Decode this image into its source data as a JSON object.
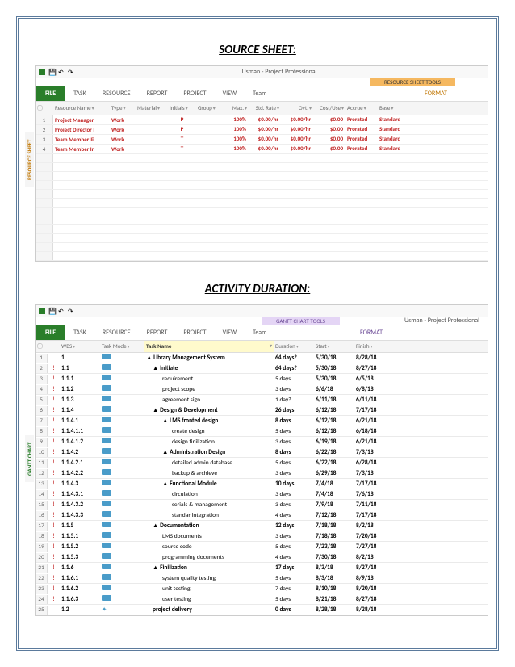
{
  "title1": "SOURCE SHEET:",
  "title2": "ACTIVITY DURATION:",
  "ribbon_tabs": [
    "FILE",
    "TASK",
    "RESOURCE",
    "REPORT",
    "PROJECT",
    "VIEW",
    "Team"
  ],
  "format_label": "FORMAT",
  "window1_title": "Usman - Project Professional",
  "tool_tab1": "RESOURCE SHEET TOOLS",
  "tool_tab2": "GANTT CHART TOOLS",
  "window2_title": "Usman - Project Professional",
  "side_label1": "RESOURCE SHEET",
  "side_label2": "GANTT CHART",
  "resource_headers": {
    "indicator": "",
    "rname": "Resource Name",
    "rtype": "Type",
    "material": "Material",
    "initials": "Initials",
    "group": "Group",
    "max": "Max.",
    "stdrate": "Std. Rate",
    "ovt": "Ovt.",
    "costuse": "Cost/Use",
    "accrue": "Accrue",
    "base": "Base"
  },
  "resources": [
    {
      "num": "1",
      "name": "Project Manager",
      "type": "Work",
      "initials": "P",
      "max": "100%",
      "std": "$0.00/hr",
      "ovt": "$0.00/hr",
      "cost": "$0.00",
      "accrue": "Prorated",
      "base": "Standard"
    },
    {
      "num": "2",
      "name": "Project Director I",
      "type": "Work",
      "initials": "P",
      "max": "100%",
      "std": "$0.00/hr",
      "ovt": "$0.00/hr",
      "cost": "$0.00",
      "accrue": "Prorated",
      "base": "Standard"
    },
    {
      "num": "3",
      "name": "Team Member Ji",
      "type": "Work",
      "initials": "T",
      "max": "100%",
      "std": "$0.00/hr",
      "ovt": "$0.00/hr",
      "cost": "$0.00",
      "accrue": "Prorated",
      "base": "Standard"
    },
    {
      "num": "4",
      "name": "Team Member In",
      "type": "Work",
      "initials": "T",
      "max": "100%",
      "std": "$0.00/hr",
      "ovt": "$0.00/hr",
      "cost": "$0.00",
      "accrue": "Prorated",
      "base": "Standard"
    }
  ],
  "gantt_headers": {
    "wbs": "WBS",
    "mode": "Task Mode",
    "tname": "Task Name",
    "dur": "Duration",
    "start": "Start",
    "finish": "Finish"
  },
  "tasks": [
    {
      "num": "1",
      "wbs": "1",
      "name": "Library Management System",
      "indent": 0,
      "bold": true,
      "dur": "64 days?",
      "start": "5/30/18",
      "finish": "8/28/18",
      "collapse": true,
      "ind": ""
    },
    {
      "num": "2",
      "wbs": "1.1",
      "name": "Initiate",
      "indent": 1,
      "bold": true,
      "dur": "64 days?",
      "start": "5/30/18",
      "finish": "8/27/18",
      "collapse": true,
      "ind": "!"
    },
    {
      "num": "3",
      "wbs": "1.1.1",
      "name": "requirement",
      "indent": 2,
      "bold": false,
      "dur": "5 days",
      "start": "5/30/18",
      "finish": "6/5/18",
      "ind": "!"
    },
    {
      "num": "4",
      "wbs": "1.1.2",
      "name": "project scope",
      "indent": 2,
      "bold": false,
      "dur": "3 days",
      "start": "6/6/18",
      "finish": "6/8/18",
      "ind": "!"
    },
    {
      "num": "5",
      "wbs": "1.1.3",
      "name": "agreement sign",
      "indent": 2,
      "bold": false,
      "dur": "1 day?",
      "start": "6/11/18",
      "finish": "6/11/18",
      "ind": "!"
    },
    {
      "num": "6",
      "wbs": "1.1.4",
      "name": "Design & Development",
      "indent": 1,
      "bold": true,
      "dur": "26 days",
      "start": "6/12/18",
      "finish": "7/17/18",
      "collapse": true,
      "ind": "!"
    },
    {
      "num": "7",
      "wbs": "1.1.4.1",
      "name": "LMS fronted design",
      "indent": 2,
      "bold": true,
      "dur": "8 days",
      "start": "6/12/18",
      "finish": "6/21/18",
      "collapse": true,
      "ind": "!"
    },
    {
      "num": "8",
      "wbs": "1.1.4.1.1",
      "name": "create design",
      "indent": 3,
      "bold": false,
      "dur": "5 days",
      "start": "6/12/18",
      "finish": "6/18/18",
      "ind": "!"
    },
    {
      "num": "9",
      "wbs": "1.1.4.1.2",
      "name": "design finilization",
      "indent": 3,
      "bold": false,
      "dur": "3 days",
      "start": "6/19/18",
      "finish": "6/21/18",
      "ind": "!"
    },
    {
      "num": "10",
      "wbs": "1.1.4.2",
      "name": "Administration Design",
      "indent": 2,
      "bold": true,
      "dur": "8 days",
      "start": "6/22/18",
      "finish": "7/3/18",
      "collapse": true,
      "ind": "!"
    },
    {
      "num": "11",
      "wbs": "1.1.4.2.1",
      "name": "detailed admin database",
      "indent": 3,
      "bold": false,
      "dur": "5 days",
      "start": "6/22/18",
      "finish": "6/28/18",
      "ind": "!"
    },
    {
      "num": "12",
      "wbs": "1.1.4.2.2",
      "name": "backup & archieve",
      "indent": 3,
      "bold": false,
      "dur": "3 days",
      "start": "6/29/18",
      "finish": "7/3/18",
      "ind": "!"
    },
    {
      "num": "13",
      "wbs": "1.1.4.3",
      "name": "Functional Module",
      "indent": 2,
      "bold": true,
      "dur": "10 days",
      "start": "7/4/18",
      "finish": "7/17/18",
      "collapse": true,
      "ind": "!"
    },
    {
      "num": "14",
      "wbs": "1.1.4.3.1",
      "name": "circulation",
      "indent": 3,
      "bold": false,
      "dur": "3 days",
      "start": "7/4/18",
      "finish": "7/6/18",
      "ind": "!"
    },
    {
      "num": "15",
      "wbs": "1.1.4.3.2",
      "name": "serials & management",
      "indent": 3,
      "bold": false,
      "dur": "3 days",
      "start": "7/9/18",
      "finish": "7/11/18",
      "ind": "!"
    },
    {
      "num": "16",
      "wbs": "1.1.4.3.3",
      "name": "standar integration",
      "indent": 3,
      "bold": false,
      "dur": "4 days",
      "start": "7/12/18",
      "finish": "7/17/18",
      "ind": "!"
    },
    {
      "num": "17",
      "wbs": "1.1.5",
      "name": "Documentation",
      "indent": 1,
      "bold": true,
      "dur": "12 days",
      "start": "7/18/18",
      "finish": "8/2/18",
      "collapse": true,
      "ind": "!"
    },
    {
      "num": "18",
      "wbs": "1.1.5.1",
      "name": "LMS documents",
      "indent": 2,
      "bold": false,
      "dur": "3 days",
      "start": "7/18/18",
      "finish": "7/20/18",
      "ind": "!"
    },
    {
      "num": "19",
      "wbs": "1.1.5.2",
      "name": "source code",
      "indent": 2,
      "bold": false,
      "dur": "5 days",
      "start": "7/23/18",
      "finish": "7/27/18",
      "ind": "!"
    },
    {
      "num": "20",
      "wbs": "1.1.5.3",
      "name": "programming documents",
      "indent": 2,
      "bold": false,
      "dur": "4 days",
      "start": "7/30/18",
      "finish": "8/2/18",
      "ind": "!"
    },
    {
      "num": "21",
      "wbs": "1.1.6",
      "name": "Finilization",
      "indent": 1,
      "bold": true,
      "dur": "17 days",
      "start": "8/3/18",
      "finish": "8/27/18",
      "collapse": true,
      "ind": "!"
    },
    {
      "num": "22",
      "wbs": "1.1.6.1",
      "name": "system quality testing",
      "indent": 2,
      "bold": false,
      "dur": "5 days",
      "start": "8/3/18",
      "finish": "8/9/18",
      "ind": "!"
    },
    {
      "num": "23",
      "wbs": "1.1.6.2",
      "name": "unit testing",
      "indent": 2,
      "bold": false,
      "dur": "7 days",
      "start": "8/10/18",
      "finish": "8/20/18",
      "ind": "!"
    },
    {
      "num": "24",
      "wbs": "1.1.6.3",
      "name": "user testing",
      "indent": 2,
      "bold": false,
      "dur": "5 days",
      "start": "8/21/18",
      "finish": "8/27/18",
      "ind": "!"
    },
    {
      "num": "25",
      "wbs": "1.2",
      "name": "project delivery",
      "indent": 1,
      "bold": true,
      "dur": "0 days",
      "start": "8/28/18",
      "finish": "8/28/18",
      "ind": "",
      "star": true
    }
  ]
}
